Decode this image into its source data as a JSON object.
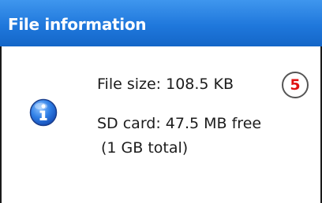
{
  "window": {
    "title": "File information"
  },
  "details": {
    "file_size": "File size: 108.5 KB",
    "sd_card_free": "SD card: 47.5 MB free",
    "sd_card_total": "(1 GB total)"
  },
  "callout": {
    "number": "5",
    "color": "#e01010"
  },
  "icons": {
    "info": "info-icon"
  },
  "colors": {
    "title_bar": "#1f78dc",
    "title_text": "#ffffff"
  }
}
